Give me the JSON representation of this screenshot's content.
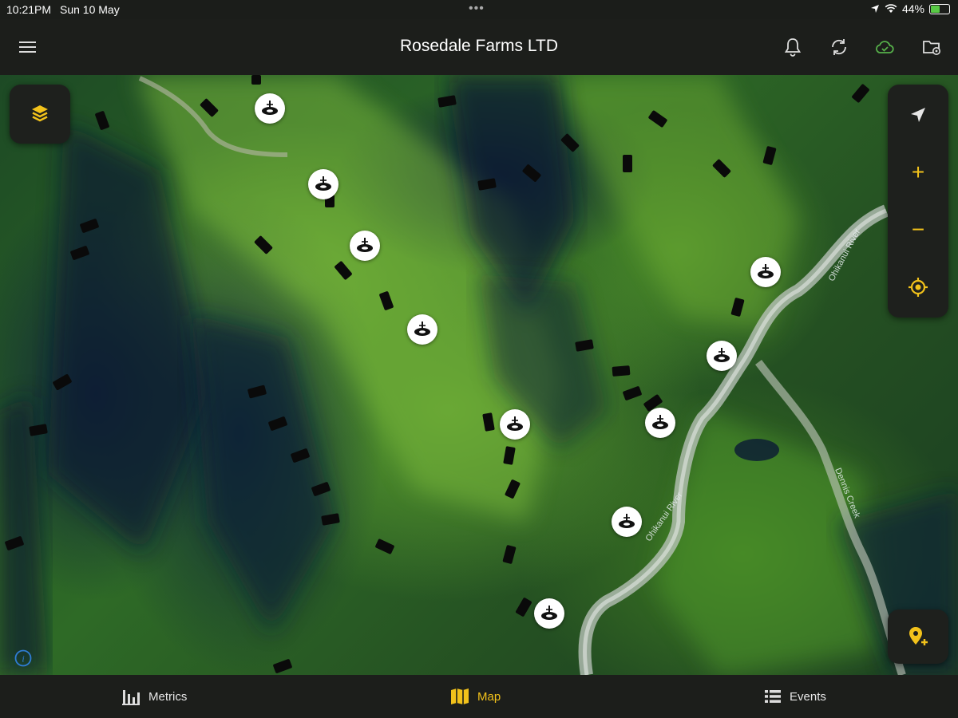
{
  "status_bar": {
    "time": "10:21PM",
    "date": "Sun 10 May",
    "battery": "44%",
    "battery_level": 0.44
  },
  "header": {
    "title": "Rosedale Farms LTD",
    "icons": [
      "menu-icon",
      "bell-icon",
      "sync-icon",
      "cloud-check-icon",
      "folder-settings-icon"
    ]
  },
  "map": {
    "river_labels": [
      "Ohikanui River",
      "Ohikanui River",
      "Dennis Creek"
    ],
    "accent": "#f2c21b",
    "marker_icon": "center-pivot-icon",
    "marker_count": 10
  },
  "controls": {
    "layers": "layers-icon",
    "navigate": "navigation-arrow-icon",
    "zoom_in": "+",
    "zoom_out": "−",
    "locate": "crosshair-icon",
    "add_pin": "add-location-pin-icon",
    "info": "i"
  },
  "tabs": {
    "metrics": "Metrics",
    "map": "Map",
    "events": "Events",
    "active": "Map"
  }
}
